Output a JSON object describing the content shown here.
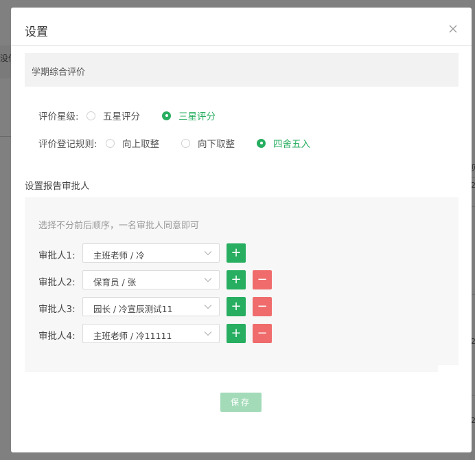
{
  "background": {
    "left_text": "没信",
    "right_glyphs": [
      "贝",
      "2",
      "2",
      "2"
    ]
  },
  "modal": {
    "title": "设置",
    "close_icon": "close-icon",
    "section_title": "学期综合评价",
    "rating_level": {
      "label": "评价星级:",
      "options": [
        {
          "label": "五星评分",
          "checked": false
        },
        {
          "label": "三星评分",
          "checked": true
        }
      ]
    },
    "rounding_rule": {
      "label": "评价登记规则:",
      "options": [
        {
          "label": "向上取整",
          "checked": false
        },
        {
          "label": "向下取整",
          "checked": false
        },
        {
          "label": "四舍五入",
          "checked": true
        }
      ]
    },
    "approvers_title": "设置报告审批人",
    "hint": "选择不分前后顺序，一名审批人同意即可",
    "approvers": [
      {
        "label": "审批人1:",
        "value": "主班老师 / 冷",
        "removable": false
      },
      {
        "label": "审批人2:",
        "value": "保育员 / 张",
        "removable": true
      },
      {
        "label": "审批人3:",
        "value": "园长 / 冷宣辰测试11",
        "removable": true
      },
      {
        "label": "审批人4:",
        "value": "主班老师 / 冷11111",
        "removable": true
      }
    ],
    "add_symbol": "+",
    "remove_symbol": "−",
    "save_label": "保存"
  },
  "colors": {
    "accent": "#27ae60",
    "danger": "#f06b6b",
    "save_disabled": "#a3dbb9"
  }
}
